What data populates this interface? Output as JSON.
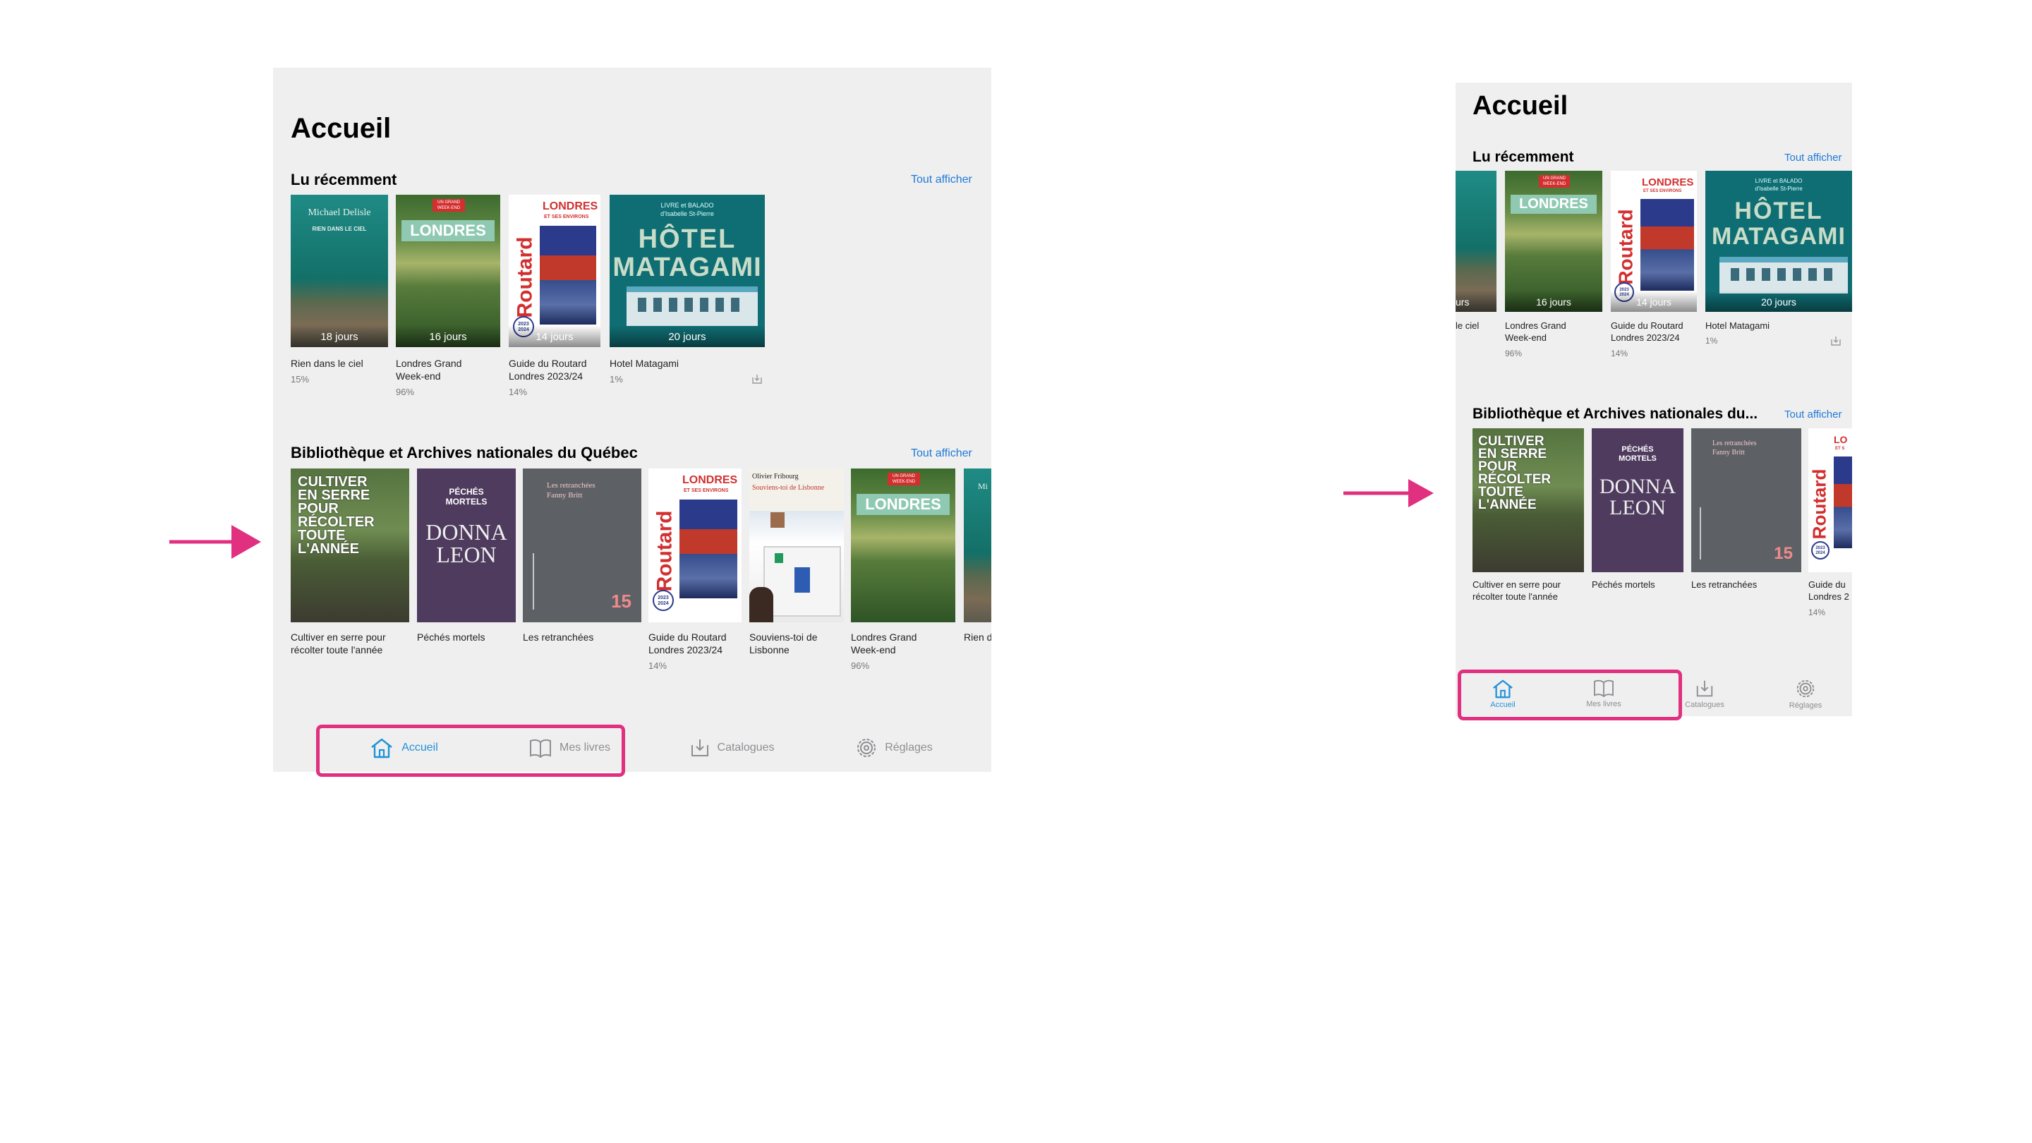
{
  "colors": {
    "accent": "#1f92d8",
    "link": "#1f7ad8",
    "highlight": "#e0307f",
    "background": "#efefef"
  },
  "left": {
    "title": "Accueil",
    "recent": {
      "title": "Lu récemment",
      "see_all": "Tout afficher",
      "books": [
        {
          "title": "Rien dans le ciel",
          "progress": "15%",
          "days": "18 jours",
          "cover_author": "Michael Delisle",
          "cover_title": "RIEN DANS LE CIEL"
        },
        {
          "title": "Londres Grand Week-end",
          "progress": "96%",
          "days": "16 jours",
          "cover_title": "LONDRES",
          "cover_badge": "UN GRAND WEEK-END"
        },
        {
          "title": "Guide du Routard Londres 2023/24",
          "progress": "14%",
          "days": "14 jours",
          "cover_title": "LONDRES",
          "cover_sub": "ET SES ENVIRONS",
          "cover_brand": "Routard",
          "cover_year": "2023 2024"
        },
        {
          "title": "Hotel Matagami",
          "progress": "1%",
          "days": "20 jours",
          "cover_kicker": "LIVRE et BALADO",
          "cover_author": "d'Isabelle St-Pierre",
          "cover_title_1": "HÔTEL",
          "cover_title_2": "MATAGAMI"
        }
      ]
    },
    "library": {
      "title": "Bibliothèque et Archives nationales du Québec",
      "see_all": "Tout afficher",
      "books": [
        {
          "title": "Cultiver en serre pour récolter toute l'année",
          "progress": "",
          "cover_lines": [
            "CULTIVER",
            "EN SERRE",
            "POUR",
            "RÉCOLTER",
            "TOUTE",
            "L'ANNÉE"
          ]
        },
        {
          "title": "Péchés mortels",
          "progress": "",
          "cover_title_1": "PÉCHÉS",
          "cover_title_2": "MORTELS",
          "cover_author_1": "DONNA",
          "cover_author_2": "LEON"
        },
        {
          "title": "Les retranchées",
          "progress": "",
          "cover_title": "Les retranchées",
          "cover_author": "Fanny Britt",
          "cover_num": "15"
        },
        {
          "title": "Guide du Routard Londres 2023/24",
          "progress": "14%",
          "cover_title": "LONDRES",
          "cover_sub": "ET SES ENVIRONS",
          "cover_brand": "Routard",
          "cover_year": "2023 2024"
        },
        {
          "title": "Souviens-toi de Lisbonne",
          "progress": "",
          "cover_author": "Olivier Fribourg",
          "cover_title": "Souviens-toi de Lisbonne"
        },
        {
          "title": "Londres Grand Week-end",
          "progress": "96%",
          "cover_title": "LONDRES",
          "cover_badge": "UN GRAND WEEK-END"
        },
        {
          "title": "Rien d",
          "progress": "",
          "cover_author": "Mi"
        }
      ]
    },
    "tabs": [
      {
        "label": "Accueil",
        "icon": "home-icon"
      },
      {
        "label": "Mes livres",
        "icon": "book-icon"
      },
      {
        "label": "Catalogues",
        "icon": "download-tray-icon"
      },
      {
        "label": "Réglages",
        "icon": "gear-icon"
      }
    ]
  },
  "right": {
    "title": "Accueil",
    "recent": {
      "title": "Lu récemment",
      "see_all": "Tout afficher",
      "books": [
        {
          "title": "le ciel",
          "progress": "",
          "days": "urs"
        },
        {
          "title": "Londres Grand Week-end",
          "progress": "96%",
          "days": "16 jours",
          "cover_title": "LONDRES",
          "cover_badge": "UN GRAND WEEK-END"
        },
        {
          "title": "Guide du Routard Londres 2023/24",
          "progress": "14%",
          "days": "14 jours",
          "cover_title": "LONDRES",
          "cover_sub": "ET SES ENVIRONS",
          "cover_brand": "Routard",
          "cover_year": "2023 2024"
        },
        {
          "title": "Hotel Matagami",
          "progress": "1%",
          "days": "20 jours",
          "cover_kicker": "LIVRE et BALADO",
          "cover_author": "d'Isabelle St-Pierre",
          "cover_title_1": "HÔTEL",
          "cover_title_2": "MATAGAMI"
        }
      ]
    },
    "library": {
      "title": "Bibliothèque et Archives nationales du...",
      "see_all": "Tout afficher",
      "books": [
        {
          "title": "Cultiver en serre pour récolter toute l'année",
          "progress": "",
          "cover_lines": [
            "CULTIVER",
            "EN SERRE",
            "POUR",
            "RÉCOLTER",
            "TOUTE",
            "L'ANNÉE"
          ]
        },
        {
          "title": "Péchés mortels",
          "progress": "",
          "cover_title_1": "PÉCHÉS",
          "cover_title_2": "MORTELS",
          "cover_author_1": "DONNA",
          "cover_author_2": "LEON"
        },
        {
          "title": "Les retranchées",
          "progress": "",
          "cover_title": "Les retranchées",
          "cover_author": "Fanny Britt",
          "cover_num": "15"
        },
        {
          "title": "Guide du Londres 2",
          "progress": "14%",
          "cover_title": "LO",
          "cover_sub": "ET S",
          "cover_brand": "Routard",
          "cover_year": "2023 2024"
        }
      ]
    },
    "tabs": [
      {
        "label": "Accueil",
        "icon": "home-icon"
      },
      {
        "label": "Mes livres",
        "icon": "book-icon"
      },
      {
        "label": "Catalogues",
        "icon": "download-tray-icon"
      },
      {
        "label": "Réglages",
        "icon": "gear-icon"
      }
    ]
  }
}
